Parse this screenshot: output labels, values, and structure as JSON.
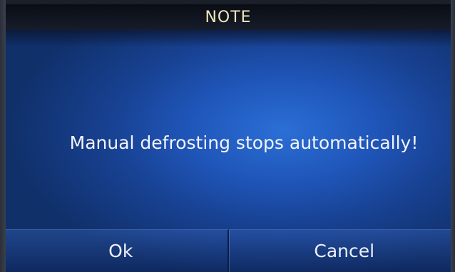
{
  "dialog": {
    "title": "NOTE",
    "message": "Manual defrosting stops automatically!",
    "buttons": {
      "ok_label": "Ok",
      "cancel_label": "Cancel"
    }
  },
  "colors": {
    "title_text": "#f1e6b8",
    "background_accent": "#1f55b8",
    "title_bar": "#0a0d14"
  }
}
